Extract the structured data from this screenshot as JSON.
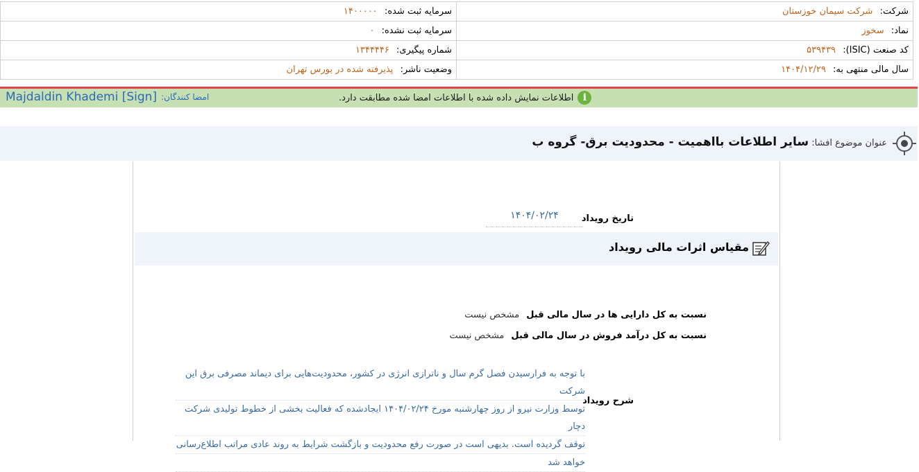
{
  "header_info": {
    "company_label": "شرکت:",
    "company_value": "شرکت سیمان خوزستان",
    "registered_capital_label": "سرمایه ثبت شده:",
    "registered_capital_value": "۱۴۰۰۰۰۰",
    "symbol_label": "نماد:",
    "symbol_value": "سخوز",
    "unregistered_capital_label": "سرمایه ثبت نشده:",
    "unregistered_capital_value": "۰",
    "isic_label": "کد صنعت (ISIC):",
    "isic_value": "۵۳۹۴۳۹",
    "tracking_label": "شماره پیگیری:",
    "tracking_value": "۱۳۴۴۴۴۶",
    "fiscal_label": "سال مالی منتهی به:",
    "fiscal_value": "۱۴۰۴/۱۲/۲۹",
    "publisher_status_label": "وضعیت ناشر:",
    "publisher_status_value": "پذیرفته شده در بورس تهران"
  },
  "signature_bar": {
    "notice": "اطلاعات نمایش داده شده با اطلاعات امضا شده مطابقت دارد.",
    "signers_label": "امضا کنندگان:",
    "signer_name": "Majdaldin Khademi [Sign]"
  },
  "subject": {
    "label": "عنوان موضوع افشا:",
    "value": "سایر اطلاعات بااهمیت - محدودیت برق- گروه ب"
  },
  "event": {
    "date_label": "تاریخ رویداد",
    "date_value": "۱۴۰۴/۰۲/۲۴"
  },
  "financial_section": {
    "title": "مقیاس اثرات مالی رویداد",
    "ratios": [
      {
        "label": "نسبت به کل دارایی ها در سال مالی قبل",
        "value": "مشخص نیست"
      },
      {
        "label": "نسبت به کل درآمد فروش در سال مالی قبل",
        "value": "مشخص نیست"
      }
    ]
  },
  "description": {
    "label": "شرح رویداد",
    "lines": [
      "با توجه به فرارسیدن فصل گرم سال و ناترازی انرژی در کشور، محدودیت‌هایی برای دیماند مصرفی برق این شرکت",
      "توسط وزارت نیرو از روز چهارشنبه مورخ ۱۴۰۴/۰۲/۲۴ ایجادشده که فعالیت بخشی از خطوط تولیدی شرکت دچار",
      "توقف گردیده است. بدیهی است در صورت رفع محدودیت و بازگشت شرایط به روند عادی مراتب اطلاع‌رسانی",
      "خواهد شد"
    ]
  },
  "colors": {
    "value_orange": "#c0651e",
    "link_blue": "#3a6aa0",
    "notice_green_bg": "#c6e0b4",
    "subject_bg": "#eef4fa",
    "divider_red": "#e04444"
  },
  "icons": [
    "info-icon",
    "target-icon",
    "edit-note-icon"
  ]
}
